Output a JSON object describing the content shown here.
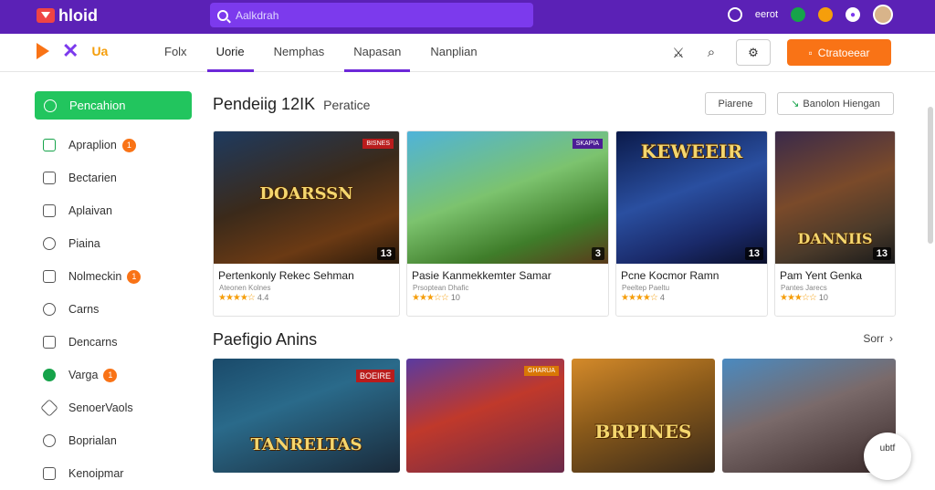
{
  "topbar": {
    "brand": "hloid",
    "search_placeholder": "Aalkdrah",
    "right_label": "eerot"
  },
  "navbar": {
    "logo_text": "Ua",
    "tabs": [
      {
        "label": "Folx"
      },
      {
        "label": "Uorie"
      },
      {
        "label": "Nemphas"
      },
      {
        "label": "Napasan"
      },
      {
        "label": "Nanplian"
      }
    ],
    "cta_label": "Ctratoeear"
  },
  "sidebar": {
    "primary": "Pencahion",
    "items": [
      {
        "label": "Apraplion",
        "badge": "1"
      },
      {
        "label": "Bectarien",
        "badge": ""
      },
      {
        "label": "Aplaivan",
        "badge": ""
      },
      {
        "label": "Piaina",
        "badge": ""
      },
      {
        "label": "Nolmeckin",
        "badge": "1"
      },
      {
        "label": "Carns",
        "badge": ""
      },
      {
        "label": "Dencarns",
        "badge": ""
      },
      {
        "label": "Varga",
        "badge": "1"
      },
      {
        "label": "SenoerVaols",
        "badge": ""
      },
      {
        "label": "Boprialan",
        "badge": ""
      },
      {
        "label": "Kenoipmar",
        "badge": ""
      }
    ]
  },
  "section1": {
    "title": "Pendeiig 12IK",
    "subtitle": "Peratice",
    "btn1": "Piarene",
    "btn2": "Banolon Hiengan"
  },
  "cards": [
    {
      "title": "Pertenkonly Rekec Sehman",
      "meta": "Ateonen Kolnes",
      "stars": "★★★★☆",
      "rating": "4.4",
      "count": "13",
      "ribbon": "BISNES",
      "word": "DOARSSN"
    },
    {
      "title": "Pasie Kanmekkemter Samar",
      "meta": "Prsoptean Dhafic",
      "stars": "★★★☆☆",
      "rating": "10",
      "count": "3",
      "ribbon": "SKAPIA",
      "word": ""
    },
    {
      "title": "Pcne Kocmor Ramn",
      "meta": "Peeltep Paeltu",
      "stars": "★★★★☆",
      "rating": "4",
      "count": "13",
      "ribbon": "",
      "word": "KEWEEIR"
    },
    {
      "title": "Pam Yent Genka",
      "meta": "Pantes Jarecs",
      "stars": "★★★☆☆",
      "rating": "10",
      "count": "13",
      "ribbon": "",
      "word": "DANNIIS"
    }
  ],
  "section2": {
    "title": "Paefigio Anins",
    "see_more": "Sorr"
  },
  "bottom_cards": [
    {
      "word": "TANRELTAS",
      "ribbon": "BOEIRE"
    },
    {
      "word": "",
      "ribbon": "GHARUA"
    },
    {
      "word": "BRPINES",
      "ribbon": ""
    },
    {
      "word": "",
      "ribbon": ""
    }
  ],
  "fab_label": "ubtf"
}
